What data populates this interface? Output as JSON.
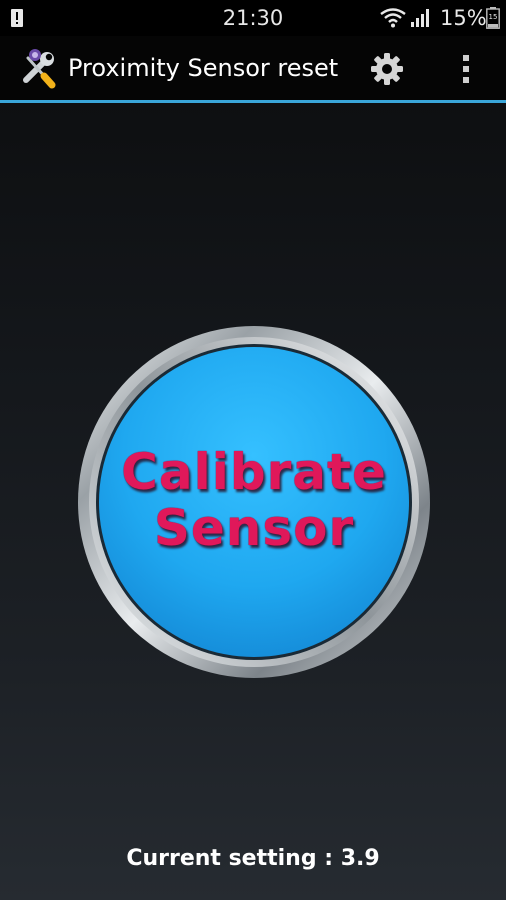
{
  "status_bar": {
    "time": "21:30",
    "battery_percent": "15%",
    "battery_level": "15",
    "icons": [
      "notification-alert-icon",
      "wifi-icon",
      "signal-icon",
      "battery-icon"
    ]
  },
  "action_bar": {
    "title": "Proximity Sensor reset",
    "icons": [
      "app-tools-icon",
      "gear-icon",
      "overflow-menu-icon"
    ],
    "accent_color": "#3aa6d9"
  },
  "main": {
    "button_line1": "Calibrate",
    "button_line2": "Sensor",
    "button_color": "#1fa8f0",
    "button_text_color": "#e0185a",
    "current_setting": "Current setting : 3.9"
  }
}
